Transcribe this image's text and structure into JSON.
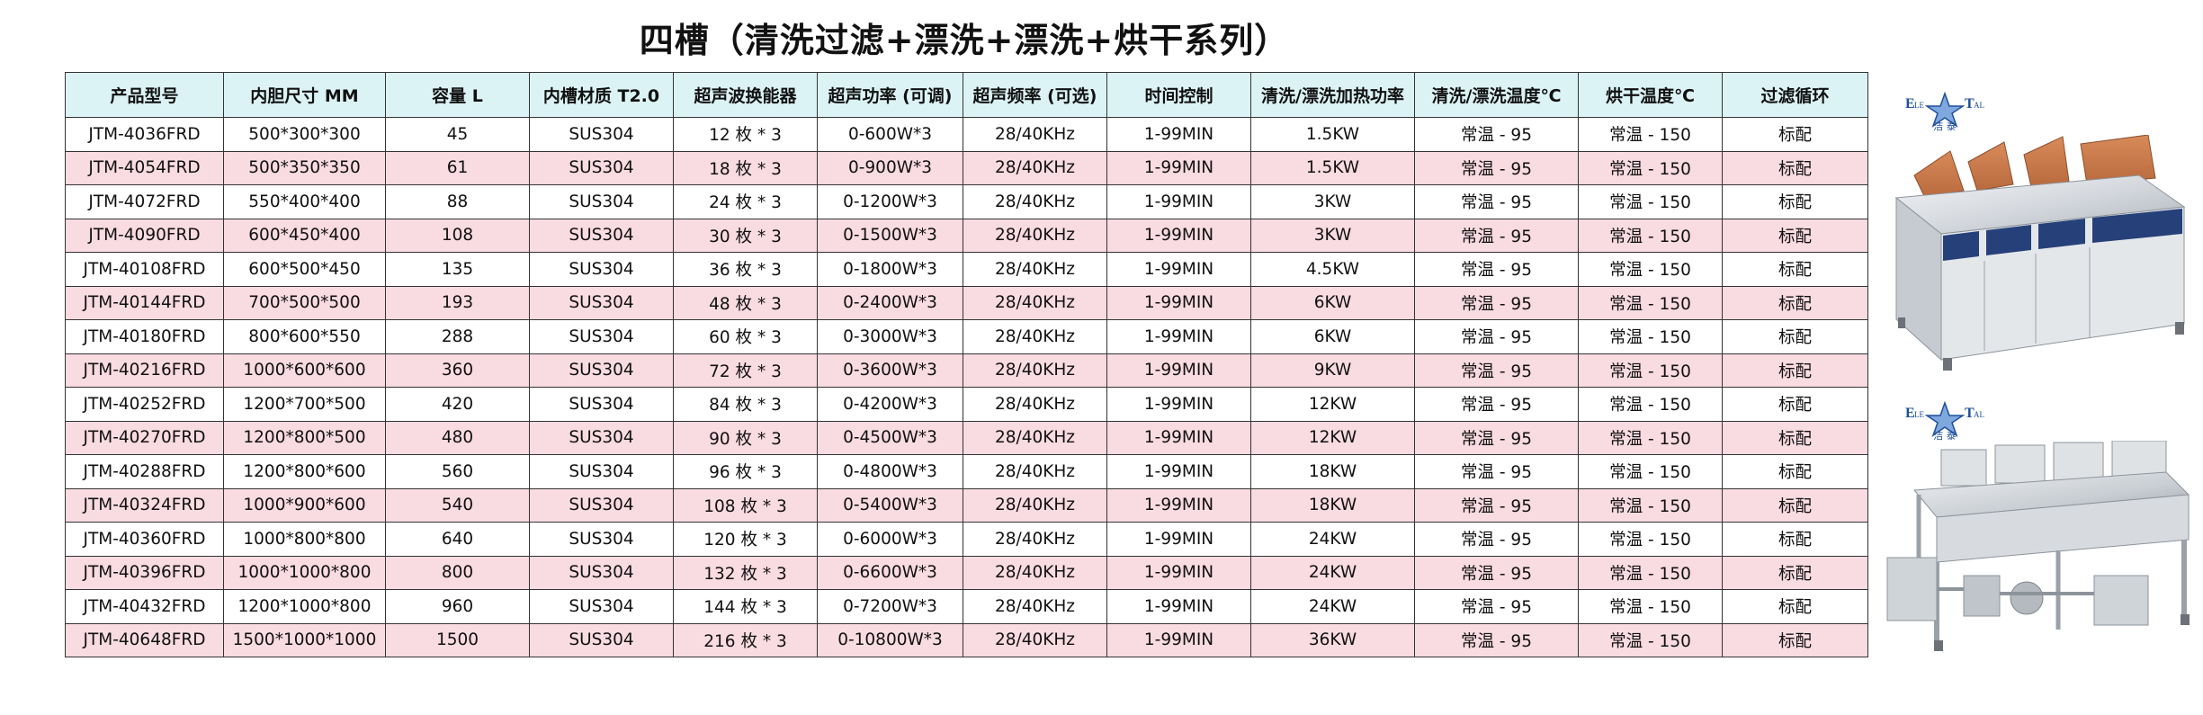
{
  "title": "四槽（清洗过滤+漂洗+漂洗+烘干系列）",
  "columns": [
    "产品型号",
    "内胆尺寸 MM",
    "容量 L",
    "内槽材质 T2.0",
    "超声波换能器",
    "超声功率 (可调)",
    "超声频率 (可选)",
    "时间控制",
    "清洗/漂洗加热功率",
    "清洗/漂洗温度℃",
    "烘干温度℃",
    "过滤循环"
  ],
  "rows": [
    [
      "JTM-4036FRD",
      "500*300*300",
      "45",
      "SUS304",
      "12 枚 * 3",
      "0-600W*3",
      "28/40KHz",
      "1-99MIN",
      "1.5KW",
      "常温 - 95",
      "常温 - 150",
      "标配"
    ],
    [
      "JTM-4054FRD",
      "500*350*350",
      "61",
      "SUS304",
      "18 枚 * 3",
      "0-900W*3",
      "28/40KHz",
      "1-99MIN",
      "1.5KW",
      "常温 - 95",
      "常温 - 150",
      "标配"
    ],
    [
      "JTM-4072FRD",
      "550*400*400",
      "88",
      "SUS304",
      "24 枚 * 3",
      "0-1200W*3",
      "28/40KHz",
      "1-99MIN",
      "3KW",
      "常温 - 95",
      "常温 - 150",
      "标配"
    ],
    [
      "JTM-4090FRD",
      "600*450*400",
      "108",
      "SUS304",
      "30 枚 * 3",
      "0-1500W*3",
      "28/40KHz",
      "1-99MIN",
      "3KW",
      "常温 - 95",
      "常温 - 150",
      "标配"
    ],
    [
      "JTM-40108FRD",
      "600*500*450",
      "135",
      "SUS304",
      "36 枚 * 3",
      "0-1800W*3",
      "28/40KHz",
      "1-99MIN",
      "4.5KW",
      "常温 - 95",
      "常温 - 150",
      "标配"
    ],
    [
      "JTM-40144FRD",
      "700*500*500",
      "193",
      "SUS304",
      "48 枚 * 3",
      "0-2400W*3",
      "28/40KHz",
      "1-99MIN",
      "6KW",
      "常温 - 95",
      "常温 - 150",
      "标配"
    ],
    [
      "JTM-40180FRD",
      "800*600*550",
      "288",
      "SUS304",
      "60 枚 * 3",
      "0-3000W*3",
      "28/40KHz",
      "1-99MIN",
      "6KW",
      "常温 - 95",
      "常温 - 150",
      "标配"
    ],
    [
      "JTM-40216FRD",
      "1000*600*600",
      "360",
      "SUS304",
      "72 枚 * 3",
      "0-3600W*3",
      "28/40KHz",
      "1-99MIN",
      "9KW",
      "常温 - 95",
      "常温 - 150",
      "标配"
    ],
    [
      "JTM-40252FRD",
      "1200*700*500",
      "420",
      "SUS304",
      "84 枚 * 3",
      "0-4200W*3",
      "28/40KHz",
      "1-99MIN",
      "12KW",
      "常温 - 95",
      "常温 - 150",
      "标配"
    ],
    [
      "JTM-40270FRD",
      "1200*800*500",
      "480",
      "SUS304",
      "90 枚 * 3",
      "0-4500W*3",
      "28/40KHz",
      "1-99MIN",
      "12KW",
      "常温 - 95",
      "常温 - 150",
      "标配"
    ],
    [
      "JTM-40288FRD",
      "1200*800*600",
      "560",
      "SUS304",
      "96 枚 * 3",
      "0-4800W*3",
      "28/40KHz",
      "1-99MIN",
      "18KW",
      "常温 - 95",
      "常温 - 150",
      "标配"
    ],
    [
      "JTM-40324FRD",
      "1000*900*600",
      "540",
      "SUS304",
      "108 枚 * 3",
      "0-5400W*3",
      "28/40KHz",
      "1-99MIN",
      "18KW",
      "常温 - 95",
      "常温 - 150",
      "标配"
    ],
    [
      "JTM-40360FRD",
      "1000*800*800",
      "640",
      "SUS304",
      "120 枚 * 3",
      "0-6000W*3",
      "28/40KHz",
      "1-99MIN",
      "24KW",
      "常温 - 95",
      "常温 - 150",
      "标配"
    ],
    [
      "JTM-40396FRD",
      "1000*1000*800",
      "800",
      "SUS304",
      "132 枚 * 3",
      "0-6600W*3",
      "28/40KHz",
      "1-99MIN",
      "24KW",
      "常温 - 95",
      "常温 - 150",
      "标配"
    ],
    [
      "JTM-40432FRD",
      "1200*1000*800",
      "960",
      "SUS304",
      "144 枚 * 3",
      "0-7200W*3",
      "28/40KHz",
      "1-99MIN",
      "24KW",
      "常温 - 95",
      "常温 - 150",
      "标配"
    ],
    [
      "JTM-40648FRD",
      "1500*1000*1000",
      "1500",
      "SUS304",
      "216 枚 * 3",
      "0-10800W*3",
      "28/40KHz",
      "1-99MIN",
      "36KW",
      "常温 - 95",
      "常温 - 150",
      "标配"
    ]
  ],
  "brand": {
    "mark_left": "E",
    "mark_left_sub": "LE",
    "mark_right": "T",
    "mark_right_sub": "AL",
    "name": "洁 泰"
  },
  "colors": {
    "header_bg": "#dcf3f5",
    "stripe_bg": "#f9dbe2",
    "brand_blue": "#1f4e99"
  },
  "icons": [
    "brand-star-logo-icon",
    "ultrasonic-cleaner-blue-panel-photo",
    "ultrasonic-cleaner-steel-frame-photo"
  ]
}
